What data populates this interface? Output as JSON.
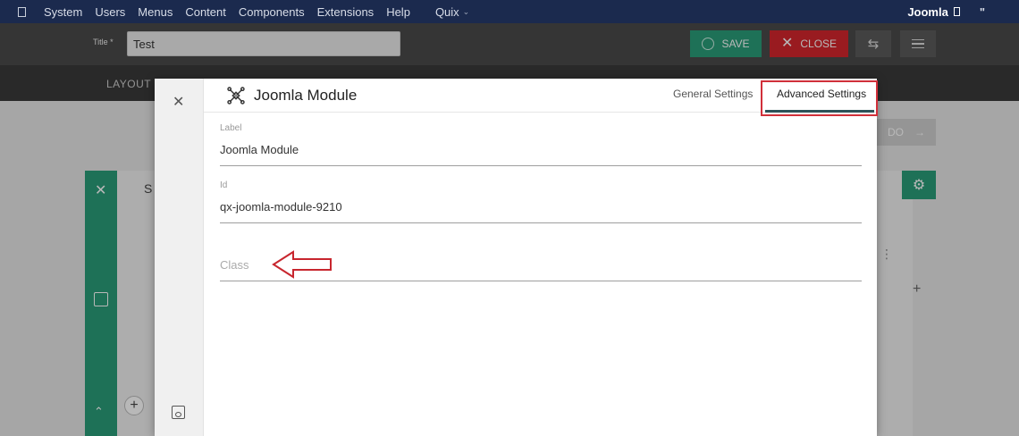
{
  "menubar": {
    "items": [
      "System",
      "Users",
      "Menus",
      "Content",
      "Components",
      "Extensions",
      "Help"
    ],
    "quix": "Quix",
    "user": "Joomla",
    "extra": "\""
  },
  "toolbar": {
    "title_label": "Title *",
    "title_value": "Test",
    "save_label": "SAVE",
    "close_label": "CLOSE"
  },
  "layoutbar": {
    "tab_label": "LAYOUT"
  },
  "builder": {
    "next_label": "DO",
    "card_letter": "S"
  },
  "modal": {
    "title": "Joomla Module",
    "tabs": {
      "general": "General Settings",
      "advanced": "Advanced Settings"
    },
    "fields": {
      "label": {
        "label": "Label",
        "value": "Joomla Module"
      },
      "id": {
        "label": "Id",
        "value": "qx-joomla-module-9210"
      },
      "class": {
        "placeholder": "Class",
        "value": ""
      }
    }
  },
  "colors": {
    "menubar": "#1b2a4e",
    "save": "#2a9d79",
    "close": "#d4262d",
    "highlight": "#d1303a",
    "tab_underline": "#2d5258"
  }
}
